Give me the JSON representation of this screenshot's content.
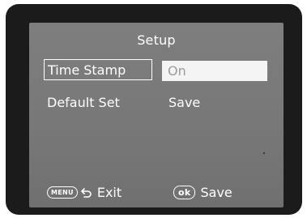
{
  "menu": {
    "title": "Setup",
    "items": [
      {
        "label": "Time Stamp",
        "value": "On",
        "selected": true
      },
      {
        "label": "Default Set",
        "value": "Save",
        "selected": false
      }
    ]
  },
  "footer": {
    "exit": {
      "key": "MENU",
      "label": "Exit",
      "icon": "back-arrow-icon"
    },
    "save": {
      "key": "ok",
      "label": "Save"
    }
  },
  "colors": {
    "screen": "#7a7a7a",
    "bezel": "#1b1b1b",
    "text": "#ffffff",
    "selected_value_bg": "#f4f4f4",
    "selected_value_text": "#9c9c9c"
  }
}
